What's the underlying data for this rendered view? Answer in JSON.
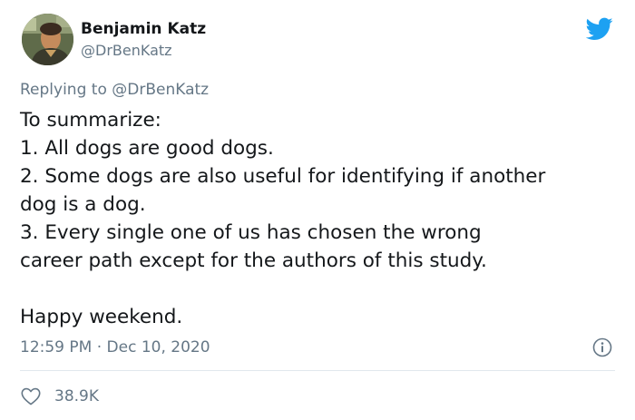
{
  "author": {
    "name": "Benjamin Katz",
    "handle": "@DrBenKatz",
    "avatar_icon": "profile-photo"
  },
  "brand": {
    "icon": "twitter-bird-icon",
    "color": "#1da1f2"
  },
  "reply": {
    "prefix": "Replying to",
    "handle": "@DrBenKatz"
  },
  "tweet": {
    "lines": [
      "To summarize:",
      "1. All dogs are good dogs.",
      "2. Some dogs are also useful for identifying if another",
      "dog is a dog.",
      "3. Every single one of us has chosen the wrong",
      "career path except for the authors of this study.",
      "Happy weekend."
    ]
  },
  "meta": {
    "time": "12:59 PM",
    "separator": "·",
    "date": "Dec 10, 2020",
    "info_icon": "info-icon"
  },
  "actions": {
    "like_icon": "heart-icon",
    "like_count": "38.9K"
  },
  "colors": {
    "text": "#14171a",
    "muted": "#657786",
    "divider": "#e1e8ed"
  }
}
